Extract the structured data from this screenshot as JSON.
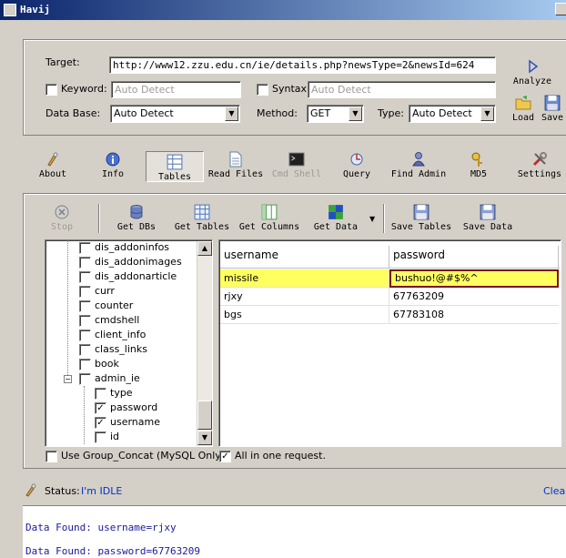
{
  "window": {
    "title": "Havij"
  },
  "target_panel": {
    "target_label": "Target:",
    "target_value": "http://www12.zzu.edu.cn/ie/details.php?newsType=2&newsId=624",
    "keyword_label": "Keyword:",
    "keyword_placeholder": "Auto Detect",
    "syntax_label": "Syntax:",
    "syntax_placeholder": "Auto Detect",
    "database_label": "Data Base:",
    "database_value": "Auto Detect",
    "method_label": "Method:",
    "method_value": "GET",
    "type_label": "Type:",
    "type_value": "Auto Detect",
    "analyze_label": "Analyze",
    "load_label": "Load",
    "save_label": "Save"
  },
  "main_tabs": [
    {
      "label": "About",
      "icon": "about-icon"
    },
    {
      "label": "Info",
      "icon": "info-icon"
    },
    {
      "label": "Tables",
      "icon": "tables-icon"
    },
    {
      "label": "Read Files",
      "icon": "file-icon"
    },
    {
      "label": "Cmd Shell",
      "icon": "cmd-icon"
    },
    {
      "label": "Query",
      "icon": "query-icon"
    },
    {
      "label": "Find Admin",
      "icon": "admin-icon"
    },
    {
      "label": "MD5",
      "icon": "md5-icon"
    },
    {
      "label": "Settings",
      "icon": "settings-icon"
    }
  ],
  "toolbar": {
    "stop": "Stop",
    "get_dbs": "Get DBs",
    "get_tables": "Get Tables",
    "get_columns": "Get Columns",
    "get_data": "Get Data",
    "save_tables": "Save Tables",
    "save_data": "Save Data"
  },
  "tree": [
    {
      "label": "dis_addoninfos",
      "checked": false,
      "level": 1
    },
    {
      "label": "dis_addonimages",
      "checked": false,
      "level": 1
    },
    {
      "label": "dis_addonarticle",
      "checked": false,
      "level": 1
    },
    {
      "label": "curr",
      "checked": false,
      "level": 1
    },
    {
      "label": "counter",
      "checked": false,
      "level": 1
    },
    {
      "label": "cmdshell",
      "checked": false,
      "level": 1
    },
    {
      "label": "client_info",
      "checked": false,
      "level": 1
    },
    {
      "label": "class_links",
      "checked": false,
      "level": 1
    },
    {
      "label": "book",
      "checked": false,
      "level": 1
    },
    {
      "label": "admin_ie",
      "checked": false,
      "level": 1,
      "expanded": true
    },
    {
      "label": "type",
      "checked": false,
      "level": 2
    },
    {
      "label": "password",
      "checked": true,
      "level": 2
    },
    {
      "label": "username",
      "checked": true,
      "level": 2
    },
    {
      "label": "id",
      "checked": false,
      "level": 2
    }
  ],
  "grid": {
    "columns": [
      "username",
      "password"
    ],
    "rows": [
      [
        "missile",
        "bushuo!@#$%^"
      ],
      [
        "rjxy",
        "67763209"
      ],
      [
        "bgs",
        "67783108"
      ]
    ]
  },
  "options": {
    "group_concat_label": "Use Group_Concat (MySQL Only)",
    "all_in_one_label": "All in one request."
  },
  "status": {
    "label": "Status:",
    "value": "I'm IDLE",
    "clear_label": "Clear"
  },
  "log": [
    "Data Found: username=rjxy",
    "Data Found: password=67763209"
  ],
  "colors": {
    "selected_row": "#ffff60",
    "link": "#0033cc",
    "log_text": "#1a1a9a"
  }
}
